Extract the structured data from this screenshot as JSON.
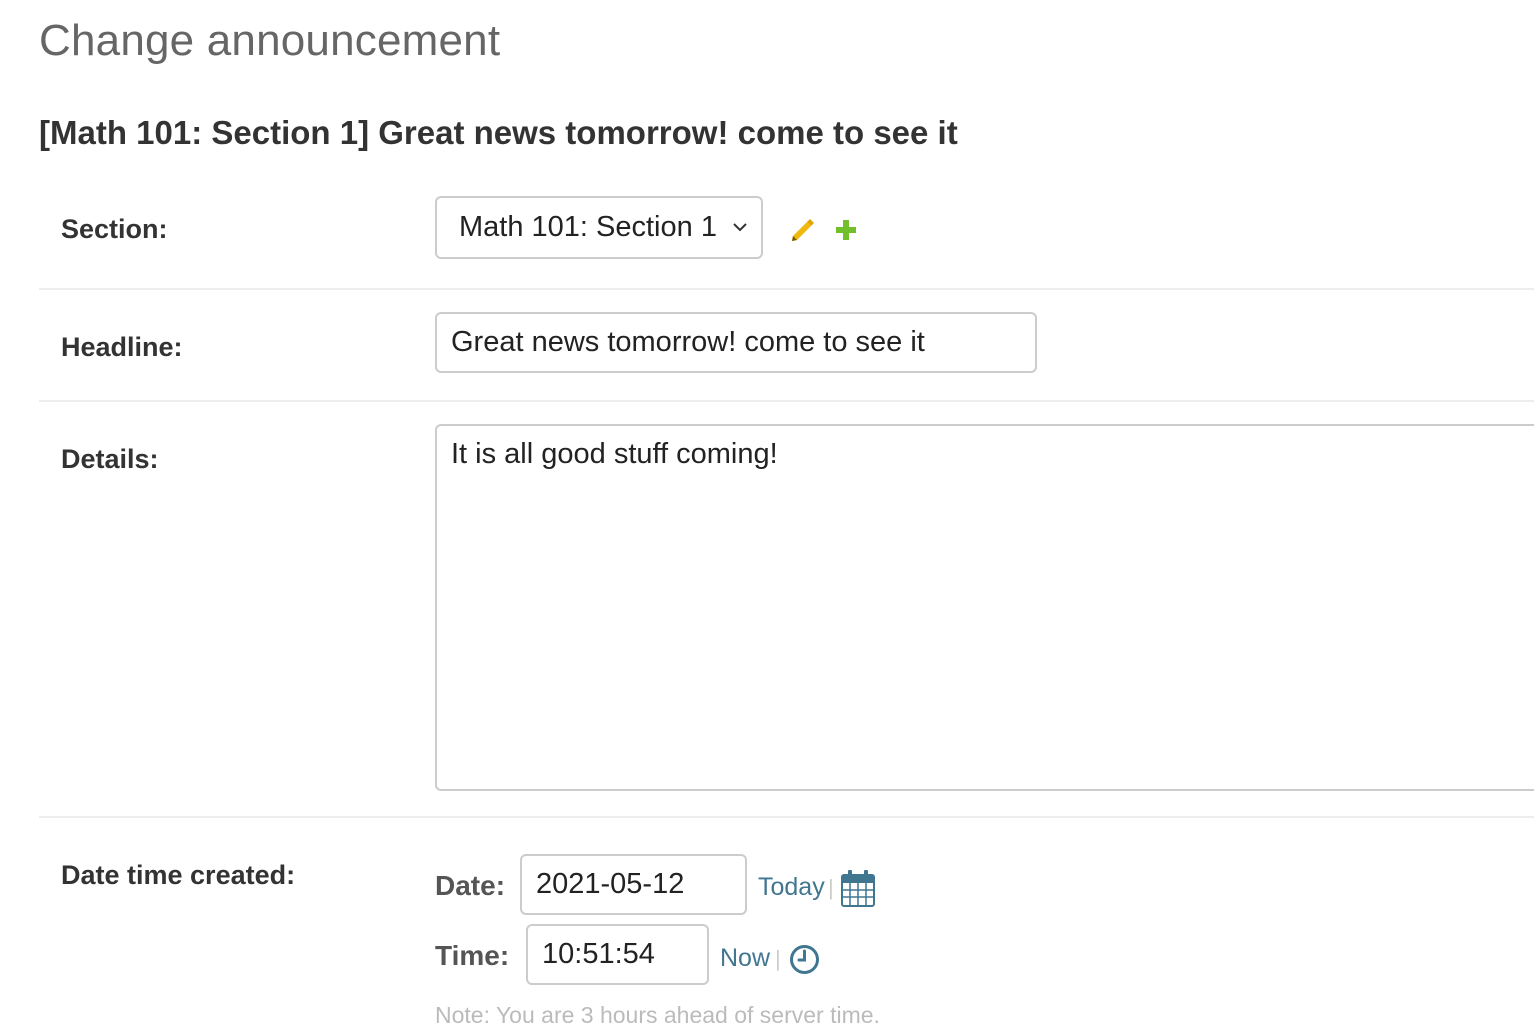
{
  "page": {
    "title": "Change announcement",
    "object_title": "[Math 101: Section 1] Great news tomorrow! come to see it"
  },
  "section": {
    "label": "Section:",
    "selected": "Math 101: Section 1",
    "icons": [
      "pencil-icon",
      "plus-icon"
    ],
    "colors": {
      "pencil": "#efb80b",
      "plus": "#70bf2b"
    }
  },
  "headline": {
    "label": "Headline:",
    "value": "Great news tomorrow! come to see it"
  },
  "details": {
    "label": "Details:",
    "value": "It is all good stuff coming!"
  },
  "date_time_created": {
    "label": "Date time created:",
    "date_label": "Date:",
    "date_value": "2021-05-12",
    "today_link": "Today",
    "separator": "|",
    "time_label": "Time:",
    "time_value": "10:51:54",
    "now_link": "Now",
    "note": "Note: You are 3 hours ahead of server time.",
    "icons": [
      "calendar-icon",
      "clock-icon"
    ],
    "link_color": "#417690"
  }
}
